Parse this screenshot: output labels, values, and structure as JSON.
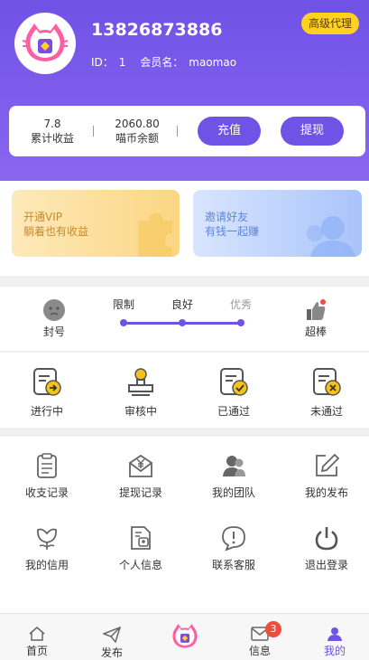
{
  "profile": {
    "phone": "13826873886",
    "id_label": "ID：",
    "id_value": "1",
    "member_label": "会员名：",
    "member_value": "maomao",
    "agent_badge": "高级代理"
  },
  "stats": {
    "total_income_value": "7.8",
    "total_income_label": "累计收益",
    "coin_balance_value": "2060.80",
    "coin_balance_label": "喵币余额",
    "recharge_label": "充值",
    "withdraw_label": "提现"
  },
  "banners": {
    "vip_title": "开通VIP",
    "vip_sub": "躺着也有收益",
    "invite_title": "邀请好友",
    "invite_sub": "有钱一起赚"
  },
  "credit": {
    "ban_label": "封号",
    "levels": [
      "限制",
      "良好",
      "优秀"
    ],
    "great_label": "超棒"
  },
  "status": [
    {
      "label": "进行中",
      "icon": "doc-arrow-icon"
    },
    {
      "label": "审核中",
      "icon": "stamp-icon"
    },
    {
      "label": "已通过",
      "icon": "doc-check-icon"
    },
    {
      "label": "未通过",
      "icon": "doc-x-icon"
    }
  ],
  "menu": [
    {
      "label": "收支记录",
      "icon": "clipboard-icon"
    },
    {
      "label": "提现记录",
      "icon": "yen-envelope-icon"
    },
    {
      "label": "我的团队",
      "icon": "team-icon"
    },
    {
      "label": "我的发布",
      "icon": "edit-icon"
    },
    {
      "label": "我的信用",
      "icon": "flower-icon"
    },
    {
      "label": "个人信息",
      "icon": "profile-doc-icon"
    },
    {
      "label": "联系客服",
      "icon": "chat-alert-icon"
    },
    {
      "label": "退出登录",
      "icon": "power-icon"
    }
  ],
  "tabs": [
    {
      "label": "首页",
      "icon": "home-icon"
    },
    {
      "label": "发布",
      "icon": "send-icon"
    },
    {
      "label": "",
      "icon": "cat-logo-icon"
    },
    {
      "label": "信息",
      "icon": "mail-icon",
      "badge": "3"
    },
    {
      "label": "我的",
      "icon": "user-icon"
    }
  ],
  "colors": {
    "primary": "#6f52e6",
    "badge": "#ffd21f",
    "alert": "#f24b3d"
  }
}
